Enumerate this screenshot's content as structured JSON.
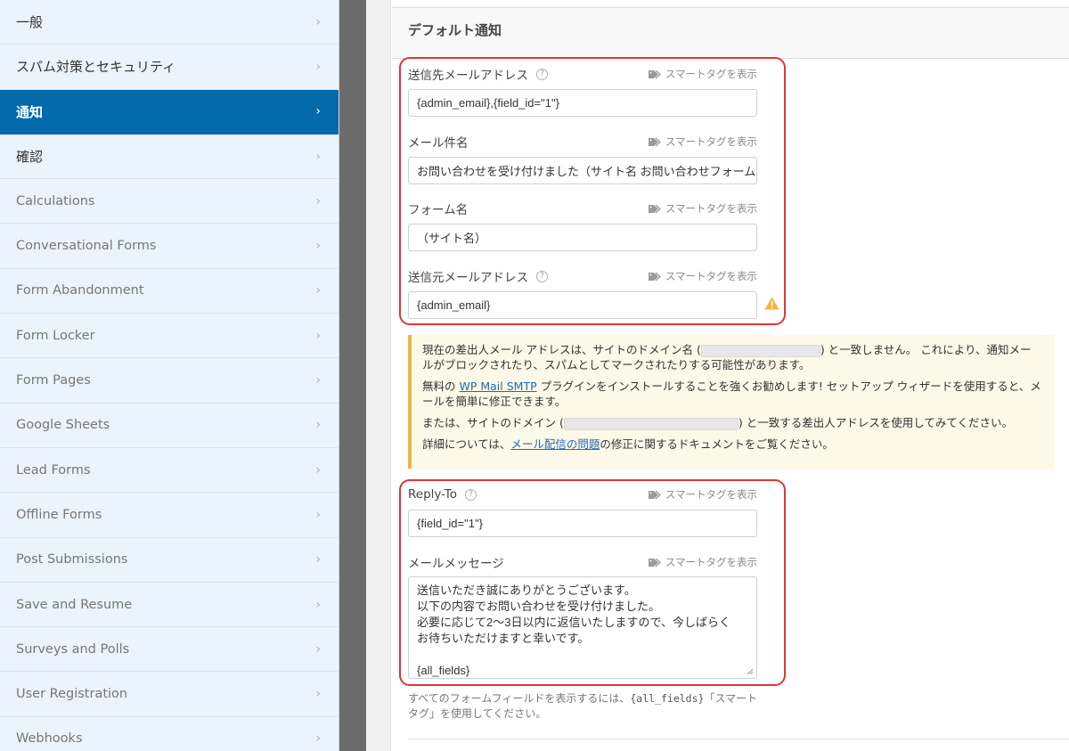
{
  "sidebar": {
    "items": [
      {
        "label": "一般"
      },
      {
        "label": "スパム対策とセキュリティ"
      },
      {
        "label": "通知"
      },
      {
        "label": "確認"
      },
      {
        "label": "Calculations"
      },
      {
        "label": "Conversational Forms"
      },
      {
        "label": "Form Abandonment"
      },
      {
        "label": "Form Locker"
      },
      {
        "label": "Form Pages"
      },
      {
        "label": "Google Sheets"
      },
      {
        "label": "Lead Forms"
      },
      {
        "label": "Offline Forms"
      },
      {
        "label": "Post Submissions"
      },
      {
        "label": "Save and Resume"
      },
      {
        "label": "Surveys and Polls"
      },
      {
        "label": "User Registration"
      },
      {
        "label": "Webhooks"
      }
    ],
    "chevron": "›",
    "active_color": "#036aab"
  },
  "panel": {
    "title": "デフォルト通知",
    "smart_tag_label": "スマートタグを表示",
    "help_glyph": "?",
    "fields": {
      "send_to": {
        "label": "送信先メールアドレス",
        "value": "{admin_email},{field_id=\"1\"}"
      },
      "subject": {
        "label": "メール件名",
        "value": "お問い合わせを受け付けました（サイト名 お問い合わせフォーム）"
      },
      "from_name": {
        "label": "フォーム名",
        "value": "（サイト名）"
      },
      "from_email": {
        "label": "送信元メールアドレス",
        "value": "{admin_email}"
      },
      "reply_to": {
        "label": "Reply-To",
        "value": "{field_id=\"1\"}"
      },
      "message": {
        "label": "メールメッセージ",
        "value": "送信いただき誠にありがとうございます。\n以下の内容でお問い合わせを受け付けました。\n必要に応じて2〜3日以内に返信いたしますので、今しばらく\nお待ちいただけますと幸いです。\n\n{all_fields}"
      }
    },
    "notice": {
      "p1_a": "現在の差出人メール アドレスは、サイトのドメイン名 (",
      "p1_b": ") と一致しません。 これにより、通知メールがブロックされたり、スパムとしてマークされたりする可能性があります。",
      "p2_a": "無料の ",
      "p2_link": "WP Mail SMTP",
      "p2_b": " プラグインをインストールすることを強くお勧めします! セットアップ ウィザードを使用すると、メールを簡単に修正できます。",
      "p3_a": "または、サイトのドメイン (",
      "p3_b": ") と一致する差出人アドレスを使用してみてください。",
      "p4_a": "詳細については、",
      "p4_link": "メール配信の問題",
      "p4_b": "の修正に関するドキュメントをご覧ください。"
    },
    "description_a": "すべてのフォームフィールドを表示するには、",
    "description_code": "{all_fields}",
    "description_b": "「スマートタグ」を使用してください。"
  },
  "colors": {
    "highlight_border": "#e03535",
    "warning": "#f2b43d",
    "link": "#1f6ab0"
  }
}
